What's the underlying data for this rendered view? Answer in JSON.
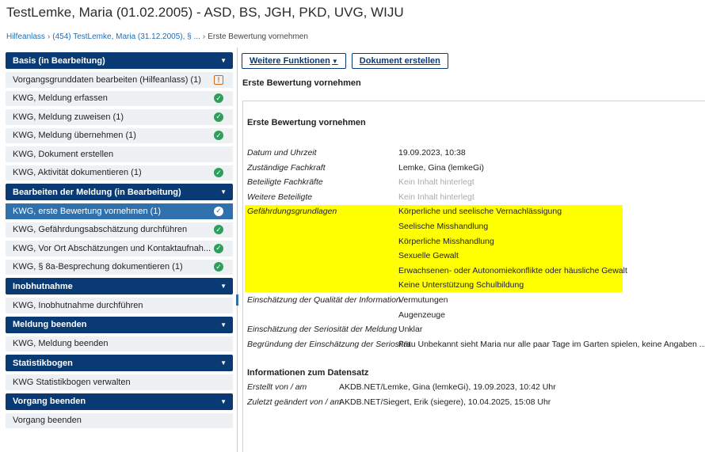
{
  "title": "TestLemke, Maria (01.02.2005) - ASD, BS, JGH, PKD, UVG, WIJU",
  "breadcrumb": {
    "items": [
      "Hilfeanlass",
      "(454) TestLemke, Maria (31.12.2005), § ...",
      "Erste Bewertung vornehmen"
    ],
    "separator": "›"
  },
  "sidebar": {
    "sections": [
      {
        "label": "Basis (in Bearbeitung)",
        "items": [
          {
            "label": "Vorgangsgrunddaten bearbeiten (Hilfeanlass) (1)",
            "icon": "warning-icon"
          },
          {
            "label": "KWG, Meldung erfassen",
            "icon": "check-icon"
          },
          {
            "label": "KWG, Meldung zuweisen (1)",
            "icon": "check-icon"
          },
          {
            "label": "KWG, Meldung übernehmen (1)",
            "icon": "check-icon"
          },
          {
            "label": "KWG, Dokument erstellen",
            "icon": ""
          },
          {
            "label": "KWG, Aktivität dokumentieren (1)",
            "icon": "check-icon"
          }
        ]
      },
      {
        "label": "Bearbeiten der Meldung (in Bearbeitung)",
        "items": [
          {
            "label": "KWG, erste Bewertung vornehmen (1)",
            "icon": "check-icon",
            "active": true
          },
          {
            "label": "KWG, Gefährdungsabschätzung durchführen",
            "icon": "check-icon"
          },
          {
            "label": "KWG, Vor Ort Abschätzungen und Kontaktaufnah...",
            "icon": "check-icon"
          },
          {
            "label": "KWG, § 8a-Besprechung dokumentieren (1)",
            "icon": "check-icon"
          }
        ]
      },
      {
        "label": "Inobhutnahme",
        "items": [
          {
            "label": "KWG, Inobhutnahme durchführen",
            "icon": ""
          }
        ]
      },
      {
        "label": "Meldung beenden",
        "items": [
          {
            "label": "KWG, Meldung beenden",
            "icon": ""
          }
        ]
      },
      {
        "label": "Statistikbogen",
        "items": [
          {
            "label": "KWG Statistikbogen verwalten",
            "icon": ""
          }
        ]
      },
      {
        "label": "Vorgang beenden",
        "items": [
          {
            "label": "Vorgang beenden",
            "icon": ""
          }
        ]
      }
    ]
  },
  "toolbar": {
    "more_functions": "Weitere Funktionen",
    "create_document": "Dokument erstellen"
  },
  "main": {
    "heading": "Erste Bewertung vornehmen",
    "doc_title": "Erste Bewertung vornehmen",
    "fields": [
      {
        "key": "Datum und Uhrzeit",
        "values": [
          "19.09.2023, 10:38"
        ]
      },
      {
        "key": "Zuständige Fachkraft",
        "values": [
          "Lemke, Gina (lemkeGi)"
        ]
      },
      {
        "key": "Beteiligte Fachkräfte",
        "values": [
          "Kein Inhalt hinterlegt"
        ],
        "muted": true
      },
      {
        "key": "Weitere Beteiligte",
        "values": [
          "Kein Inhalt hinterlegt"
        ],
        "muted": true
      },
      {
        "key": "Gefährdungsgrundlagen",
        "values": [
          "Körperliche und seelische Vernachlässigung",
          "Seelische Misshandlung",
          "Körperliche Misshandlung",
          "Sexuelle Gewalt",
          "Erwachsenen- oder Autonomiekonflikte oder häusliche Gewalt",
          "Keine Unterstützung Schulbildung"
        ],
        "highlight": true
      },
      {
        "key": "Einschätzung der Qualität der Information",
        "values": [
          "Vermutungen",
          "Augenzeuge"
        ]
      },
      {
        "key": "Einschätzung der Seriosität der Meldung",
        "values": [
          "Unklar"
        ]
      },
      {
        "key": "Begründung der Einschätzung der Seriosität",
        "values": [
          "Frau Unbekannt sieht Maria nur alle paar Tage im Garten spielen, keine Angaben ....."
        ]
      }
    ],
    "meta_title": "Informationen zum Datensatz",
    "meta": [
      {
        "key": "Erstellt von / am",
        "value": "AKDB.NET/Lemke, Gina (lemkeGi), 19.09.2023, 10:42 Uhr"
      },
      {
        "key": "Zuletzt geändert von / am",
        "value": "AKDB.NET/Siegert, Erik (siegere), 10.04.2025, 15:08 Uhr"
      }
    ],
    "highlight_color": "#ffff00"
  },
  "colors": {
    "section_header": "#0a3a73",
    "active_item": "#2f70ad",
    "check": "#2e9e5b",
    "warning": "#d06a1a",
    "link": "#1f6fb5"
  }
}
